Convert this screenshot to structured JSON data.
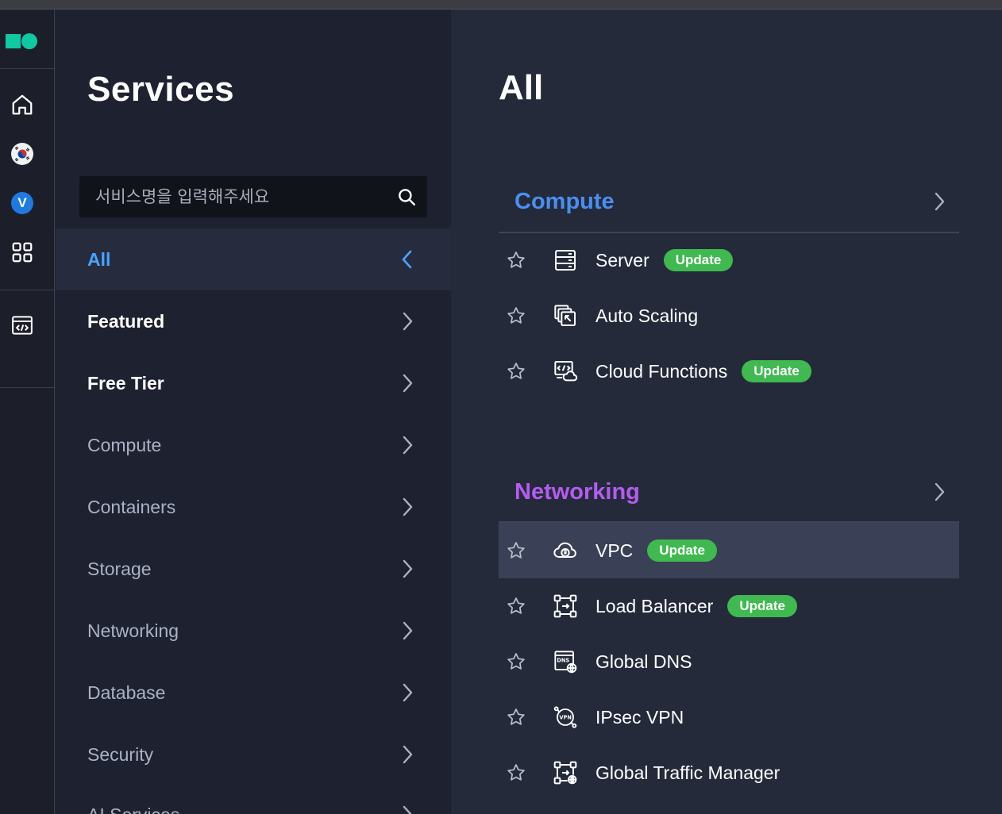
{
  "rail": {
    "logo": "logo-mark",
    "items": [
      {
        "name": "home-icon"
      },
      {
        "name": "korea-flag-icon"
      },
      {
        "name": "v-badge-icon",
        "text": "V"
      },
      {
        "name": "apps-grid-icon"
      },
      {
        "name": "code-window-icon"
      }
    ],
    "accent": "#10c9a2"
  },
  "sidebar": {
    "title": "Services",
    "search_placeholder": "서비스명을 입력해주세요",
    "categories": [
      {
        "label": "All",
        "state": "active"
      },
      {
        "label": "Featured",
        "state": "bold"
      },
      {
        "label": "Free Tier",
        "state": "bold"
      },
      {
        "label": "Compute",
        "state": "dim"
      },
      {
        "label": "Containers",
        "state": "dim"
      },
      {
        "label": "Storage",
        "state": "dim"
      },
      {
        "label": "Networking",
        "state": "dim"
      },
      {
        "label": "Database",
        "state": "dim"
      },
      {
        "label": "Security",
        "state": "dim"
      },
      {
        "label": "AI Services",
        "state": "dim"
      }
    ]
  },
  "main": {
    "title": "All",
    "badge_text": "Update",
    "sections": [
      {
        "title": "Compute",
        "color": "#4a8ff0",
        "items": [
          {
            "name": "Server",
            "icon": "server-icon",
            "update": true
          },
          {
            "name": "Auto Scaling",
            "icon": "auto-scaling-icon",
            "update": false
          },
          {
            "name": "Cloud Functions",
            "icon": "cloud-functions-icon",
            "update": true
          }
        ]
      },
      {
        "title": "Networking",
        "color": "#b45cf0",
        "items": [
          {
            "name": "VPC",
            "icon": "vpc-icon",
            "update": true
          },
          {
            "name": "Load Balancer",
            "icon": "load-balancer-icon",
            "update": true
          },
          {
            "name": "Global DNS",
            "icon": "global-dns-icon",
            "update": false
          },
          {
            "name": "IPsec VPN",
            "icon": "ipsec-vpn-icon",
            "update": false
          },
          {
            "name": "Global Traffic Manager",
            "icon": "global-traffic-manager-icon",
            "update": false
          }
        ]
      }
    ]
  }
}
